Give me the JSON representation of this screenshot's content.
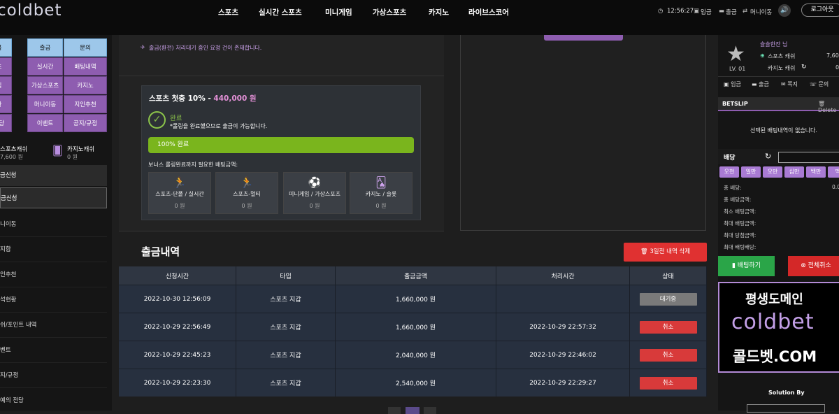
{
  "header": {
    "logo": "coldbet",
    "nav": [
      "스포츠",
      "실시간 스포츠",
      "미니게임",
      "가상스포츠",
      "카지노",
      "라이브스코어"
    ],
    "clock": "12:56:27",
    "deposit": "입금",
    "withdraw": "출금",
    "minigame": "머니이동",
    "login": "로그아웃"
  },
  "left": {
    "grid": [
      [
        "금",
        "출금",
        "문의"
      ],
      [
        "츠",
        "실시간",
        "배팅내역"
      ],
      [
        "임",
        "가상스포츠",
        "카지노"
      ],
      [
        "황",
        "머니이동",
        "지인추천"
      ],
      [
        "전당",
        "이벤트",
        "공지/규정"
      ]
    ],
    "sports_cash_label": "스포츠캐쉬",
    "sports_cash_val": "7,600 원",
    "casino_cash_label": "카지노캐쉬",
    "casino_cash_val": "0 원",
    "section1": "금신청",
    "section2": "금신청",
    "items": [
      "니이동",
      "지함",
      "인추천",
      "석현황",
      "쉬/포인트 내역",
      "벤트",
      "지/규정",
      "예의 전당"
    ]
  },
  "notice": "출금(환전) 처리대기 중인 요청 건이 존재합니다.",
  "bonus": {
    "title_prefix": "스포츠 첫충 10% - ",
    "title_amount": "440,000 원",
    "done": "완료",
    "done_desc": "*롤링을 완료했으므로 출금이 가능합니다.",
    "progress_label": "100% 완료",
    "progress": 1.0,
    "req_label": "보너스 롤링완료까지 필요한 배팅금액:",
    "cats": [
      {
        "label": "스포츠-단폴 / 실시간",
        "amount": "0 원",
        "icon": "runner-icon"
      },
      {
        "label": "스포츠-멀티",
        "amount": "0 원",
        "icon": "runner-icon"
      },
      {
        "label": "미니게임 / 가상스포츠",
        "amount": "0 원",
        "icon": "ball-icon"
      },
      {
        "label": "카지노 / 슬롯",
        "amount": "0 원",
        "icon": "cards-icon"
      }
    ]
  },
  "withdraw_history": {
    "title": "출금내역",
    "delete_btn": "3일전 내역 삭제",
    "headers": [
      "신청시간",
      "타입",
      "출금금액",
      "처리시간",
      "상태"
    ],
    "rows": [
      {
        "req": "2022-10-30 12:56:09",
        "type": "스포츠 지갑",
        "amount": "1,660,000 원",
        "proc": "",
        "status": "대기중"
      },
      {
        "req": "2022-10-29 22:56:49",
        "type": "스포츠 지갑",
        "amount": "1,660,000 원",
        "proc": "2022-10-29 22:57:32",
        "status": "취소"
      },
      {
        "req": "2022-10-29 22:45:23",
        "type": "스포츠 지갑",
        "amount": "2,040,000 원",
        "proc": "2022-10-29 22:46:02",
        "status": "취소"
      },
      {
        "req": "2022-10-29 22:23:30",
        "type": "스포츠 지갑",
        "amount": "2,540,000 원",
        "proc": "2022-10-29 22:29:27",
        "status": "취소"
      }
    ]
  },
  "right": {
    "username": "슬슬한잔 님",
    "level": "LV. 01",
    "sports_cash_label": "스포츠 캐쉬",
    "sports_cash_val": "7,600",
    "casino_cash_label": "카지노 캐쉬",
    "casino_cash_val": "0",
    "links": [
      "입금",
      "출금",
      "쪽지",
      "문의"
    ],
    "betslip": "BETSLIP",
    "delete": "Delete",
    "empty": "선택된 배팅내역이 없습니다.",
    "bet_label": "배당",
    "amounts": [
      "오천",
      "일만",
      "오만",
      "십만",
      "백만",
      "맥"
    ],
    "lines": [
      {
        "label": "총 배당:",
        "val": "0.0"
      },
      {
        "label": "총 배당금액:",
        "val": ""
      },
      {
        "label": "최소 배팅금액:",
        "val": ""
      },
      {
        "label": "최대 배팅금액:",
        "val": ""
      },
      {
        "label": "최대 당첨금액:",
        "val": ""
      },
      {
        "label": "최대 배팅배당:",
        "val": ""
      }
    ],
    "bet_btn": "배팅하기",
    "clear_btn": "전체취소",
    "banner_line1": "평생도메인",
    "banner_logo": "coldbet",
    "banner_line2": "콜드벳.COM",
    "solution": "Solution By"
  }
}
